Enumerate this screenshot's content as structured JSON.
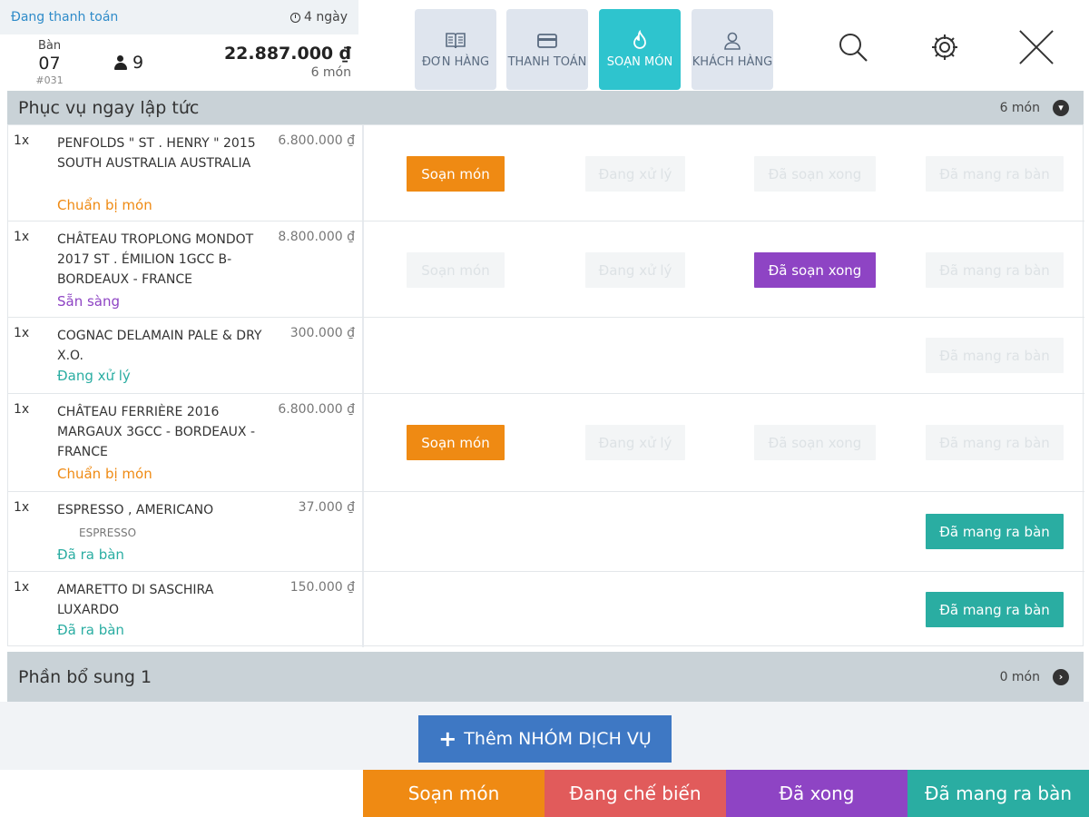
{
  "order": {
    "status": "Đang thanh toán",
    "age": "4 ngày",
    "table_label": "Bàn",
    "table_number": "07",
    "order_code": "#031",
    "guests": "9",
    "total": "22.887.000 ₫",
    "item_count": "6 món"
  },
  "tabs": [
    {
      "label": "ĐƠN HÀNG",
      "icon": "menu-book-icon"
    },
    {
      "label": "THANH TOÁN",
      "icon": "credit-card-icon"
    },
    {
      "label": "SOẠN MÓN",
      "icon": "flame-icon"
    },
    {
      "label": "KHÁCH HÀNG",
      "icon": "user-icon"
    }
  ],
  "sections": {
    "first": {
      "title": "Phục vụ ngay lập tức",
      "count": "6 món"
    },
    "second": {
      "title": "Phần bổ sung 1",
      "count": "0 món"
    }
  },
  "items": [
    {
      "qty": "1x",
      "name": "PENFOLDS \" ST . HENRY \" 2015 SOUTH AUSTRALIA AUSTRALIA",
      "price": "6.800.000 ₫",
      "status": "Chuẩn bị món",
      "status_color": "#ef8a13"
    },
    {
      "qty": "1x",
      "name": "CHÂTEAU TROPLONG MONDOT 2017 ST . ÉMILION 1GCC B- BORDEAUX - FRANCE",
      "price": "8.800.000 ₫",
      "status": "Sẵn sàng",
      "status_color": "#8e44c4"
    },
    {
      "qty": "1x",
      "name": "COGNAC DELAMAIN PALE & DRY X.O.",
      "price": "300.000 ₫",
      "status": "Đang xử lý",
      "status_color": "#2aada2"
    },
    {
      "qty": "1x",
      "name": "CHÂTEAU FERRIÈRE 2016 MARGAUX 3GCC - BORDEAUX - FRANCE",
      "price": "6.800.000 ₫",
      "status": "Chuẩn bị món",
      "status_color": "#ef8a13"
    },
    {
      "qty": "1x",
      "name": "ESPRESSO , AMERICANO",
      "price": "37.000 ₫",
      "sub": "ESPRESSO",
      "status": "Đã ra bàn",
      "status_color": "#2aada2"
    },
    {
      "qty": "1x",
      "name": "AMARETTO DI SASCHIRA LUXARDO",
      "price": "150.000 ₫",
      "status": "Đã ra bàn",
      "status_color": "#2aada2"
    }
  ],
  "actions": {
    "soan": "Soạn món",
    "dang": "Đang xử lý",
    "xong": "Đã soạn xong",
    "mang": "Đã mang ra bàn"
  },
  "add_group_label": "Thêm NHÓM DỊCH VỤ",
  "bottom": [
    "Soạn món",
    "Đang chế biến",
    "Đã xong",
    "Đã mang ra bàn"
  ]
}
